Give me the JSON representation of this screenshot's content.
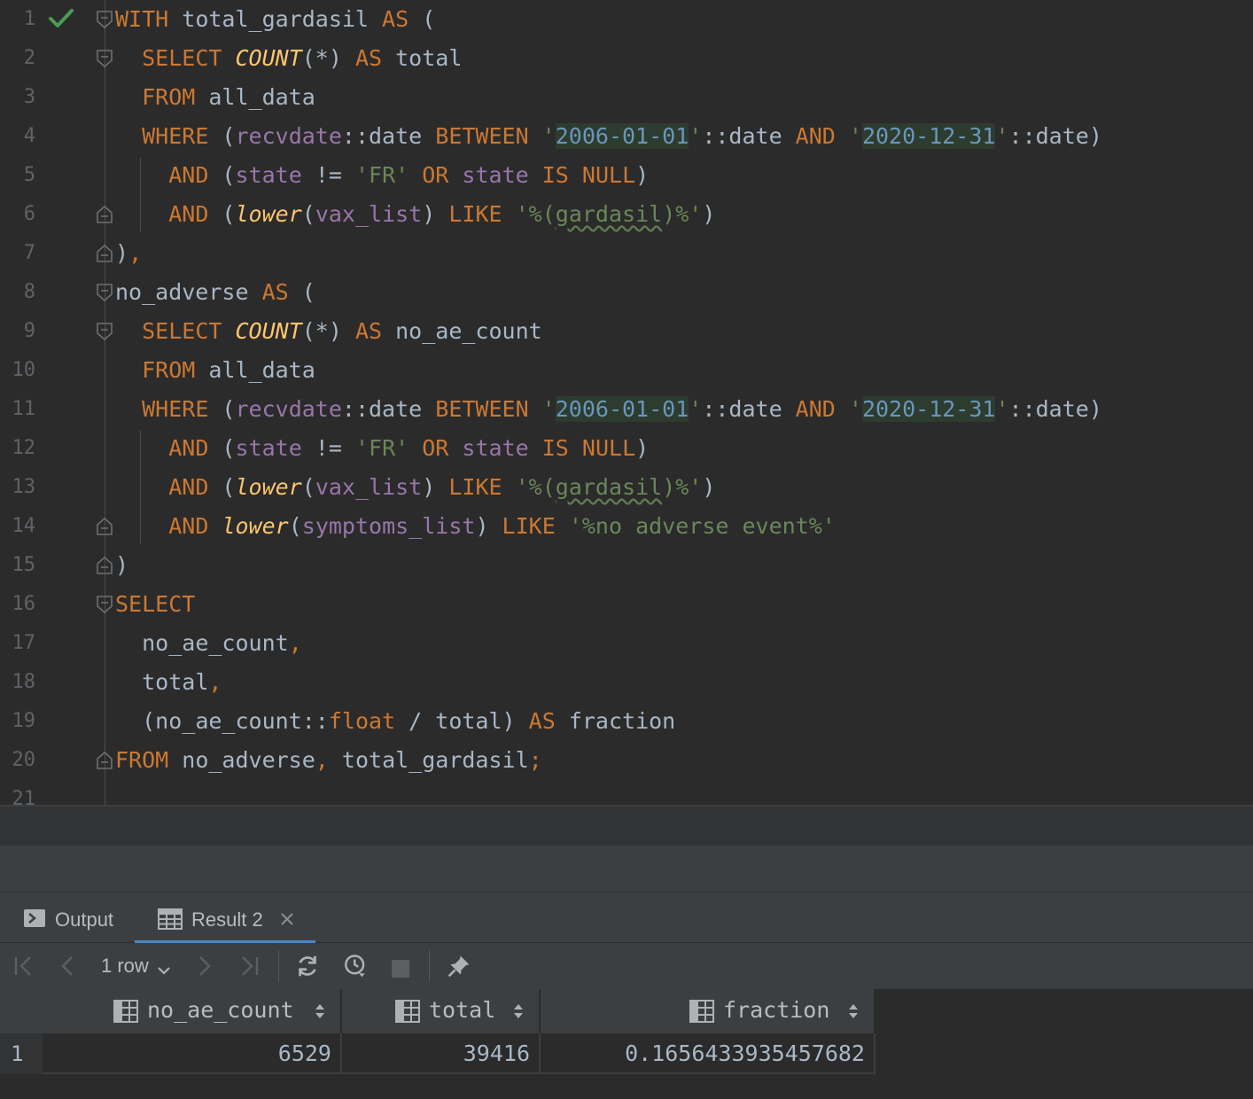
{
  "editor": {
    "line_numbers": [
      "1",
      "2",
      "3",
      "4",
      "5",
      "6",
      "7",
      "8",
      "9",
      "10",
      "11",
      "12",
      "13",
      "14",
      "15",
      "16",
      "17",
      "18",
      "19",
      "20",
      "21"
    ],
    "tokens": {
      "l1_kw_with": "WITH",
      "l1_name": " total_gardasil ",
      "l1_kw_as": "AS",
      "l1_paren": " (",
      "select": "SELECT",
      "count": "COUNT",
      "star": "(*)",
      "as": "AS",
      "total": " total",
      "from": "FROM",
      "all_data": " all_data",
      "where": "WHERE",
      "open_paren": " (",
      "recvdate": "recvdate",
      "cast_date": "::date ",
      "between": "BETWEEN",
      "quote_space": " '",
      "date_start": "2006-01-01",
      "quote_cast": "'::date ",
      "and": "AND",
      "date_end": "2020-12-31",
      "cast_close": "'::date)",
      "state": "state",
      "neq": " != ",
      "fr": "'FR'",
      "or": "OR",
      "is": "IS",
      "null": "NULL",
      "close_paren": ")",
      "lower": "lower",
      "vax_list": "vax_list",
      "like": "LIKE",
      "pat_open": "'%(",
      "gardasil": "gardasil",
      "pat_close": ")%'",
      "close_comma": "),",
      "no_adverse": "no_adverse ",
      "no_ae_count_alias": " no_ae_count",
      "symptoms_list": "symptoms_list",
      "no_ae_pat": "'%no adverse event%'",
      "no_ae_count": "no_ae_count",
      "comma": ",",
      "total_plain": "total",
      "cast_float": "::",
      "float": "float",
      "div": " / ",
      "fraction": " fraction",
      "from_sources": " no_adverse",
      "total_gardasil": " total_gardasil",
      "semicolon": ";"
    }
  },
  "tool_window": {
    "tabs": [
      {
        "label": "Output",
        "icon": "console-icon"
      },
      {
        "label": "Result 2",
        "icon": "table-icon",
        "close_icon": "close-icon"
      }
    ],
    "toolbar": {
      "rows_label": "1 row",
      "icons": [
        "first-page-icon",
        "prev-page-icon",
        "rows-dropdown-icon",
        "next-page-icon",
        "last-page-icon",
        "refresh-icon",
        "history-icon",
        "stop-icon",
        "pin-icon"
      ]
    },
    "grid": {
      "columns": [
        "no_ae_count",
        "total",
        "fraction"
      ],
      "rows": [
        {
          "row_number": "1",
          "values": [
            "6529",
            "39416",
            "0.1656433935457682"
          ]
        }
      ]
    }
  },
  "colors": {
    "background": "#2b2b2b",
    "keyword": "#cc7832",
    "function": "#ffc66d",
    "column": "#9876aa",
    "string": "#6a8759",
    "date_literal": "#6897bb",
    "success_check": "#499c54",
    "tab_underline": "#4a88c7"
  }
}
